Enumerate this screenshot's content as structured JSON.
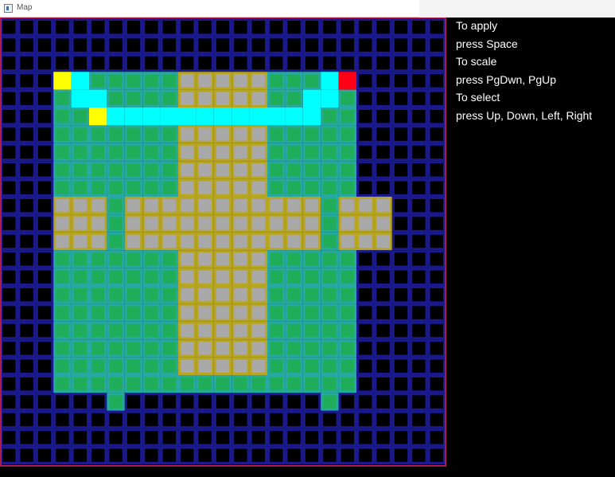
{
  "window": {
    "title": "Map",
    "app_icon": "window-app-icon"
  },
  "instructions": [
    "To apply",
    "press Space",
    "To scale",
    "press PgDwn, PgUp",
    "To select",
    "press Up, Down, Left, Right"
  ],
  "map": {
    "columns": 25,
    "rows": 25,
    "colors": {
      "background": "#000000",
      "grid_line": "#1a1a8e",
      "frame": "#b01a4a",
      "grass_fill": "#1fad5a",
      "grass_line": "#25a9a0",
      "stone_fill": "#a9a9a9",
      "stone_line": "#b8a520",
      "cyan_fill": "#00ffff",
      "yellow_fill": "#ffff00",
      "red_fill": "#ff0016"
    },
    "grass_rects": [
      [
        3,
        3,
        19,
        20
      ],
      [
        6,
        21,
        6,
        21
      ],
      [
        18,
        21,
        18,
        21
      ]
    ],
    "stone_rects": [
      [
        10,
        3,
        14,
        9
      ],
      [
        3,
        10,
        5,
        12
      ],
      [
        7,
        10,
        17,
        12
      ],
      [
        19,
        10,
        21,
        12
      ],
      [
        10,
        13,
        14,
        19
      ]
    ],
    "grass_override_cells": [
      [
        6,
        10
      ],
      [
        6,
        11
      ],
      [
        6,
        12
      ],
      [
        18,
        10
      ],
      [
        18,
        11
      ],
      [
        18,
        12
      ]
    ],
    "cyan_cells": [
      [
        4,
        3
      ],
      [
        4,
        4
      ],
      [
        5,
        4
      ],
      [
        6,
        5
      ],
      [
        7,
        5
      ],
      [
        8,
        5
      ],
      [
        9,
        5
      ],
      [
        10,
        5
      ],
      [
        11,
        5
      ],
      [
        12,
        5
      ],
      [
        13,
        5
      ],
      [
        14,
        5
      ],
      [
        15,
        5
      ],
      [
        16,
        5
      ],
      [
        17,
        5
      ],
      [
        18,
        3
      ],
      [
        17,
        4
      ],
      [
        18,
        4
      ]
    ],
    "yellow_cells": [
      [
        3,
        3
      ],
      [
        5,
        5
      ]
    ],
    "red_cells": [
      [
        19,
        3
      ]
    ]
  }
}
